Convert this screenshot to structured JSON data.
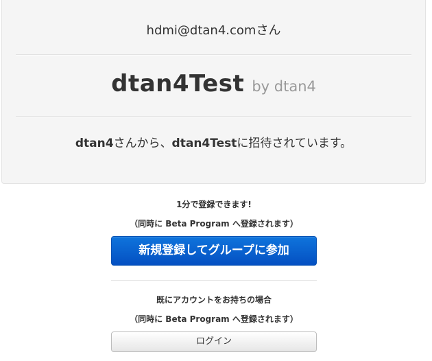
{
  "invite": {
    "email_line": "hdmi@dtan4.comさん",
    "group_name": "dtan4Test",
    "group_owner": "by dtan4",
    "message": {
      "inviter": "dtan4",
      "part1": "さんから、",
      "group": "dtan4Test",
      "part2": "に招待されています。"
    }
  },
  "signup": {
    "caption": "1分で登録できます!",
    "beta_note": "（同時に Beta Program へ登録されます）",
    "button_label": "新規登録してグループに参加"
  },
  "login": {
    "caption": "既にアカウントをお持ちの場合",
    "beta_note": "（同時に Beta Program へ登録されます）",
    "button_label": "ログイン"
  },
  "colors": {
    "primary": "#0a62d0",
    "panel_bg": "#f5f5f5",
    "muted_text": "#999999"
  }
}
